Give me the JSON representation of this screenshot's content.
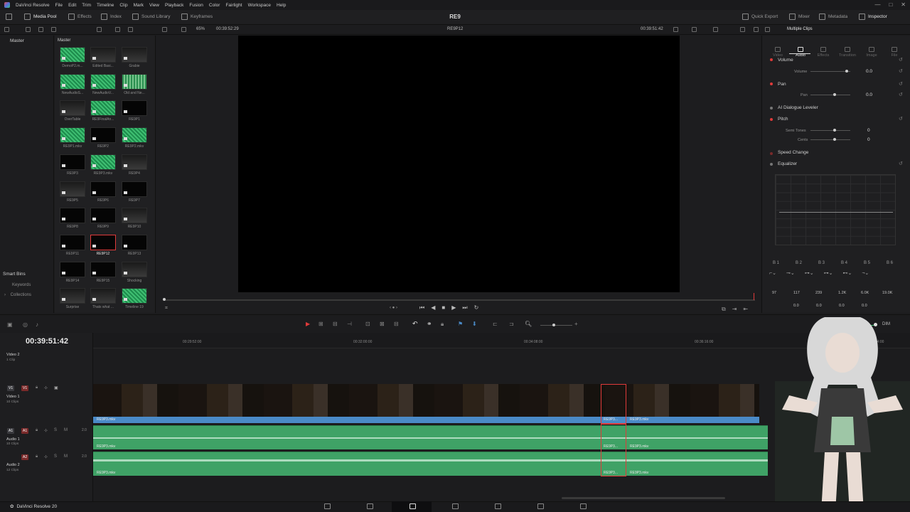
{
  "app": {
    "menu": [
      "DaVinci Resolve",
      "File",
      "Edit",
      "Trim",
      "Timeline",
      "Clip",
      "Mark",
      "View",
      "Playback",
      "Fusion",
      "Color",
      "Fairlight",
      "Workspace",
      "Help"
    ],
    "project_title": "RE9",
    "window_controls": [
      "—",
      "□",
      "✕"
    ]
  },
  "toolbar": {
    "left": [
      {
        "label": "Media Pool",
        "icon": "media-pool-icon"
      },
      {
        "label": "Effects",
        "icon": "effects-icon"
      },
      {
        "label": "Index",
        "icon": "index-icon"
      },
      {
        "label": "Sound Library",
        "icon": "sound-library-icon"
      },
      {
        "label": "Keyframes",
        "icon": "keyframes-icon"
      }
    ],
    "right": [
      {
        "label": "Quick Export",
        "icon": "export-icon"
      },
      {
        "label": "Mixer",
        "icon": "mixer-icon"
      },
      {
        "label": "Metadata",
        "icon": "metadata-icon"
      },
      {
        "label": "Inspector",
        "icon": "inspector-icon"
      }
    ]
  },
  "toolbar2": {
    "zoom": "65%",
    "source_timecode": "00:39:52:29",
    "clip_name": "RE9P12",
    "record_timecode": "00:39:51:42",
    "inspector_title": "Multiple Clips"
  },
  "bins": {
    "master": "Master",
    "smart_bins": "Smart Bins",
    "items": [
      "Keywords",
      "Collections"
    ]
  },
  "media_pool": {
    "header": "Master",
    "clips": [
      {
        "label": "DemoP2.m...",
        "style": "green"
      },
      {
        "label": "Edited Basi...",
        "style": "dark"
      },
      {
        "label": "Grabie",
        "style": "dark"
      },
      {
        "label": "NewAudioS...",
        "style": "green"
      },
      {
        "label": "NewAudioV...",
        "style": "green"
      },
      {
        "label": "Old and Ne...",
        "style": "bars"
      },
      {
        "label": "OverTable",
        "style": "dark"
      },
      {
        "label": "RE9FinalAn...",
        "style": "green"
      },
      {
        "label": "RE9P1",
        "style": "black"
      },
      {
        "label": "RE9P1.mkv",
        "style": "green"
      },
      {
        "label": "RE9P2",
        "style": "black"
      },
      {
        "label": "RE9P2.mkv",
        "style": "green"
      },
      {
        "label": "RE9P3",
        "style": "black"
      },
      {
        "label": "RE9P3.mkv",
        "style": "green"
      },
      {
        "label": "RE9P4",
        "style": "dark"
      },
      {
        "label": "RE9P5",
        "style": "dark"
      },
      {
        "label": "RE9P6",
        "style": "black"
      },
      {
        "label": "RE9P7",
        "style": "black"
      },
      {
        "label": "RE9P8",
        "style": "black"
      },
      {
        "label": "RE9P9",
        "style": "black"
      },
      {
        "label": "RE9P10",
        "style": "dark"
      },
      {
        "label": "RE9P11",
        "style": "black"
      },
      {
        "label": "RE9P12",
        "style": "sel"
      },
      {
        "label": "RE9P13",
        "style": "black"
      },
      {
        "label": "RE9P14",
        "style": "black"
      },
      {
        "label": "RE9P15",
        "style": "black"
      },
      {
        "label": "Shocking",
        "style": "dark"
      },
      {
        "label": "Surprise",
        "style": "dark"
      },
      {
        "label": "Thats what ...",
        "style": "dark"
      },
      {
        "label": "Timeline 19",
        "style": "green"
      }
    ]
  },
  "inspector": {
    "tabs": [
      "Video",
      "Audio",
      "Effects",
      "Transition",
      "Image",
      "File"
    ],
    "active_tab": "Audio",
    "volume": {
      "title": "Volume",
      "param": "Volume",
      "value": "0.0"
    },
    "pan": {
      "title": "Pan",
      "param": "Pan",
      "value": "0.0"
    },
    "dialogue": {
      "title": "AI Dialogue Leveler"
    },
    "pitch": {
      "title": "Pitch",
      "semitones_label": "Semi Tones",
      "semitones": "0",
      "cents_label": "Cents",
      "cents": "0"
    },
    "speed": {
      "title": "Speed Change"
    },
    "eq": {
      "title": "Equalizer",
      "bands": [
        "B 1",
        "B 2",
        "B 3",
        "B 4",
        "B 5",
        "B 6"
      ],
      "freqs": [
        "97",
        "117",
        "239",
        "1.2K",
        "6.0K",
        "19.0K"
      ],
      "gains": [
        "0.0",
        "0.0",
        "0.0",
        "0.0"
      ]
    }
  },
  "timeline": {
    "timecode": "00:39:51:42",
    "ruler": [
      "00:29:52:00",
      "00:32:00:00",
      "00:34:08:00",
      "00:36:16:00",
      "00:38:24:00"
    ],
    "tracks": [
      {
        "tag": "",
        "name": "Video 2",
        "sub": "1 Clip"
      },
      {
        "tag": "V1",
        "name": "Video 1",
        "sub": "10 Clips"
      },
      {
        "tag": "A1",
        "name": "Audio 1",
        "sub": "10 Clips",
        "level": "2.0"
      },
      {
        "tag": "A2",
        "name": "Audio 2",
        "sub": "12 Clips",
        "level": "2.0"
      }
    ],
    "clips": {
      "video_left": "RE9P3.mkv",
      "video_mid": "RE9P3...",
      "video_right": "RE9P3.mkv",
      "a1_left": "RE9P3.mkv",
      "a1_mid": "RE9P3...",
      "a1_right": "RE9P3.mkv",
      "a2_left": "RE9P3.mkv",
      "a2_mid": "RE9P3...",
      "a2_right": "RE9P3.mkv"
    },
    "dim_label": "DIM"
  },
  "footer": {
    "brand": "DaVinci Resolve 20",
    "pages": [
      "media-page-icon",
      "cut-page-icon",
      "edit-page-icon",
      "fusion-page-icon",
      "color-page-icon",
      "fairlight-page-icon",
      "deliver-page-icon"
    ],
    "active_page": "edit-page-icon"
  },
  "colors": {
    "accent_red": "#e03a3a",
    "video_clip_blue": "#4a8ac7",
    "audio_clip_green": "#3fa266"
  }
}
